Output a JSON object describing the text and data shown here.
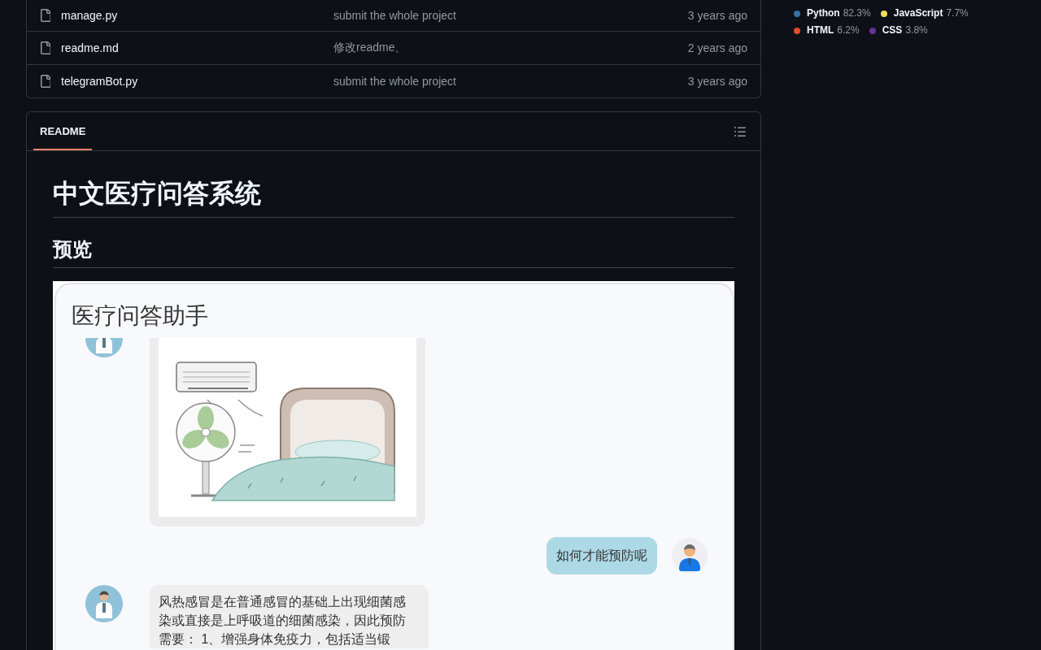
{
  "files": [
    {
      "name": "manage.py",
      "message": "submit the whole project",
      "time": "3 years ago"
    },
    {
      "name": "readme.md",
      "message": "修改readme、",
      "time": "2 years ago"
    },
    {
      "name": "telegramBot.py",
      "message": "submit the whole project",
      "time": "3 years ago"
    }
  ],
  "languages": [
    {
      "name": "Python",
      "percent": "82.3%",
      "color": "#3572a5"
    },
    {
      "name": "JavaScript",
      "percent": "7.7%",
      "color": "#f1e05a"
    },
    {
      "name": "HTML",
      "percent": "6.2%",
      "color": "#e34c26"
    },
    {
      "name": "CSS",
      "percent": "3.8%",
      "color": "#663399"
    }
  ],
  "readme": {
    "tabs": [
      {
        "label": "README",
        "selected": true
      }
    ],
    "title": "中文医疗问答系统",
    "heading": "预览",
    "preview": {
      "title": "医疗问答助手",
      "messages": [
        {
          "kind": "image",
          "outgoing": false
        },
        {
          "kind": "text",
          "outgoing": true,
          "text": "如何才能预防呢"
        },
        {
          "kind": "text",
          "outgoing": false,
          "text": "风热感冒是在普通感冒的基础上出现细菌感染或直接是上呼吸道的细菌感染，因此预防需要： 1、增强身体免疫力，包括适当锻"
        }
      ]
    }
  }
}
